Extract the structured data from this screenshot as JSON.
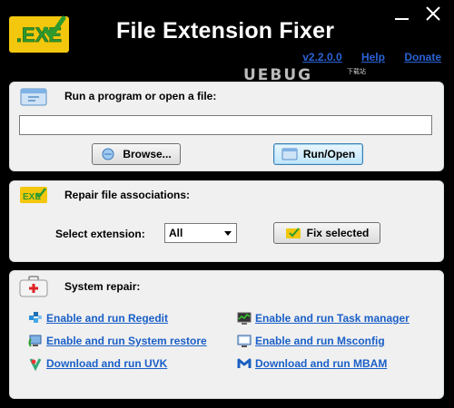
{
  "app": {
    "logo_text": ".EXE",
    "title": "File Extension Fixer"
  },
  "window_controls": {
    "minimize_icon": "minimize-icon",
    "close_icon": "close-icon"
  },
  "top_links": {
    "version": "v2.2.0.0",
    "help": "Help",
    "donate": "Donate"
  },
  "watermark": {
    "text": "UEBUG",
    "sub": "下载站"
  },
  "run_section": {
    "title": "Run a program or open a file:",
    "input_value": "",
    "browse_label": "Browse...",
    "run_label": "Run/Open"
  },
  "repair_section": {
    "title": "Repair file associations:",
    "select_label": "Select extension:",
    "select_value": "All",
    "fix_label": "Fix selected"
  },
  "system_section": {
    "title": "System repair:",
    "links": {
      "regedit": "Enable and run Regedit",
      "restore": "Enable and run System restore",
      "uvk": "Download and run UVK",
      "taskmgr": "Enable and run Task manager",
      "msconfig": "Enable and run Msconfig",
      "mbam": "Download and run MBAM"
    }
  },
  "colors": {
    "background": "#000000",
    "panel": "#f0f0f0",
    "link": "#1a5fc8",
    "logo_yellow": "#f2c70d",
    "logo_green": "#2e9a2e"
  }
}
